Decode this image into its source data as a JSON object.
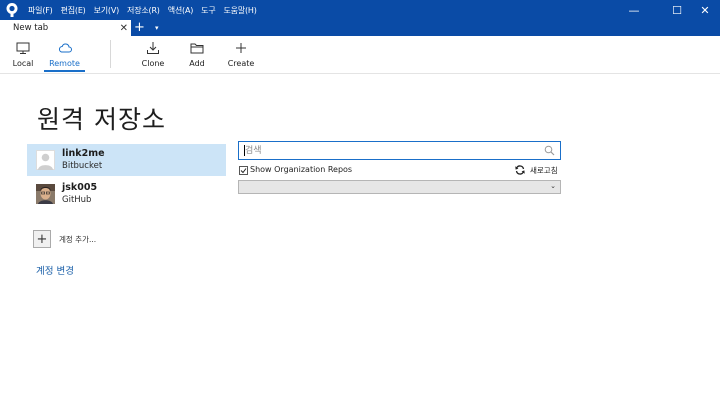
{
  "menu": {
    "items": [
      "파일(F)",
      "편집(E)",
      "보기(V)",
      "저장소(R)",
      "액션(A)",
      "도구",
      "도움말(H)"
    ]
  },
  "window_controls": {
    "minimize": "—",
    "maximize": "☐",
    "close": "✕"
  },
  "tabs": [
    {
      "label": "New tab",
      "close": "✕"
    }
  ],
  "tab_add": "+",
  "tab_menu": "▾",
  "toolbar": {
    "items": [
      {
        "label": "Local",
        "icon": "monitor-icon"
      },
      {
        "label": "Remote",
        "icon": "cloud-icon",
        "active": true
      },
      {
        "label": "Clone",
        "icon": "download-icon"
      },
      {
        "label": "Add",
        "icon": "folder-icon"
      },
      {
        "label": "Create",
        "icon": "plus-icon"
      }
    ]
  },
  "page": {
    "title": "원격 저장소"
  },
  "accounts": [
    {
      "name": "link2me",
      "host": "Bitbucket",
      "selected": true
    },
    {
      "name": "jsk005",
      "host": "GitHub",
      "selected": false
    }
  ],
  "add_account": {
    "button": "+",
    "label": "계정 추가..."
  },
  "change_account": "계정 변경",
  "search": {
    "placeholder": "검색",
    "value": ""
  },
  "show_org_repos": {
    "label": "Show Organization Repos",
    "checked": true
  },
  "refresh": {
    "label": "새로고침"
  },
  "repo_select": {
    "value": "",
    "chevron": "⌄"
  },
  "colors": {
    "titlebar": "#0a4ba6",
    "accent": "#1a6fc9",
    "selection": "#cce4f7"
  }
}
